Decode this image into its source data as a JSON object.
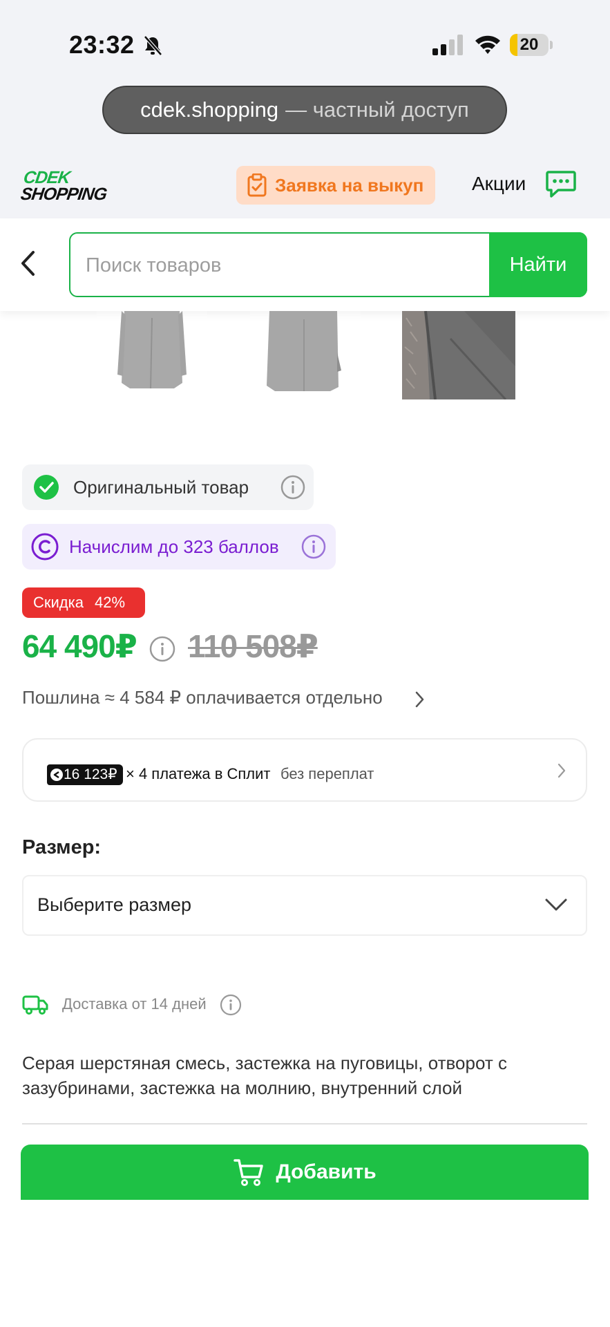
{
  "status_bar": {
    "time": "23:32",
    "battery": "20",
    "battery_level": 0.2
  },
  "browser": {
    "domain": "cdek.shopping",
    "mode": "— частный доступ"
  },
  "header": {
    "logo_top": "CDEK",
    "logo_bottom": "SHOPPING",
    "buyout_label": "Заявка на выкуп",
    "promo_label": "Акции",
    "icons": [
      "clipboard-check-icon",
      "chat-icon"
    ]
  },
  "search": {
    "placeholder": "Поиск товаров",
    "value": "",
    "button": "Найти"
  },
  "product": {
    "original_label": "Оригинальный товар",
    "bonus_label": "Начислим до 323 баллов",
    "discount_label": "Скидка",
    "discount_value": "42%",
    "price": "64 490₽",
    "old_price": "110 508₽",
    "duty": "Пошлина ≈ 4 584 ₽ оплачивается отдельно",
    "split": {
      "amount": "16 123₽",
      "text": "× 4 платежа в Сплит",
      "extra": "без переплат"
    },
    "size_label": "Размер:",
    "size_placeholder": "Выберите размер",
    "delivery": "Доставка от 14 дней",
    "description": "Серая шерстяная смесь, застежка на пуговицы, отворот с зазубринами, застежка на молнию, внутренний слой"
  },
  "cta": {
    "add_label": "Добавить"
  },
  "colors": {
    "brand_green": "#1ec145",
    "price_green": "#1ab248",
    "discount_red": "#e9302f",
    "bonus_purple": "#7a1dd1",
    "buyout_orange": "#f0771f"
  }
}
